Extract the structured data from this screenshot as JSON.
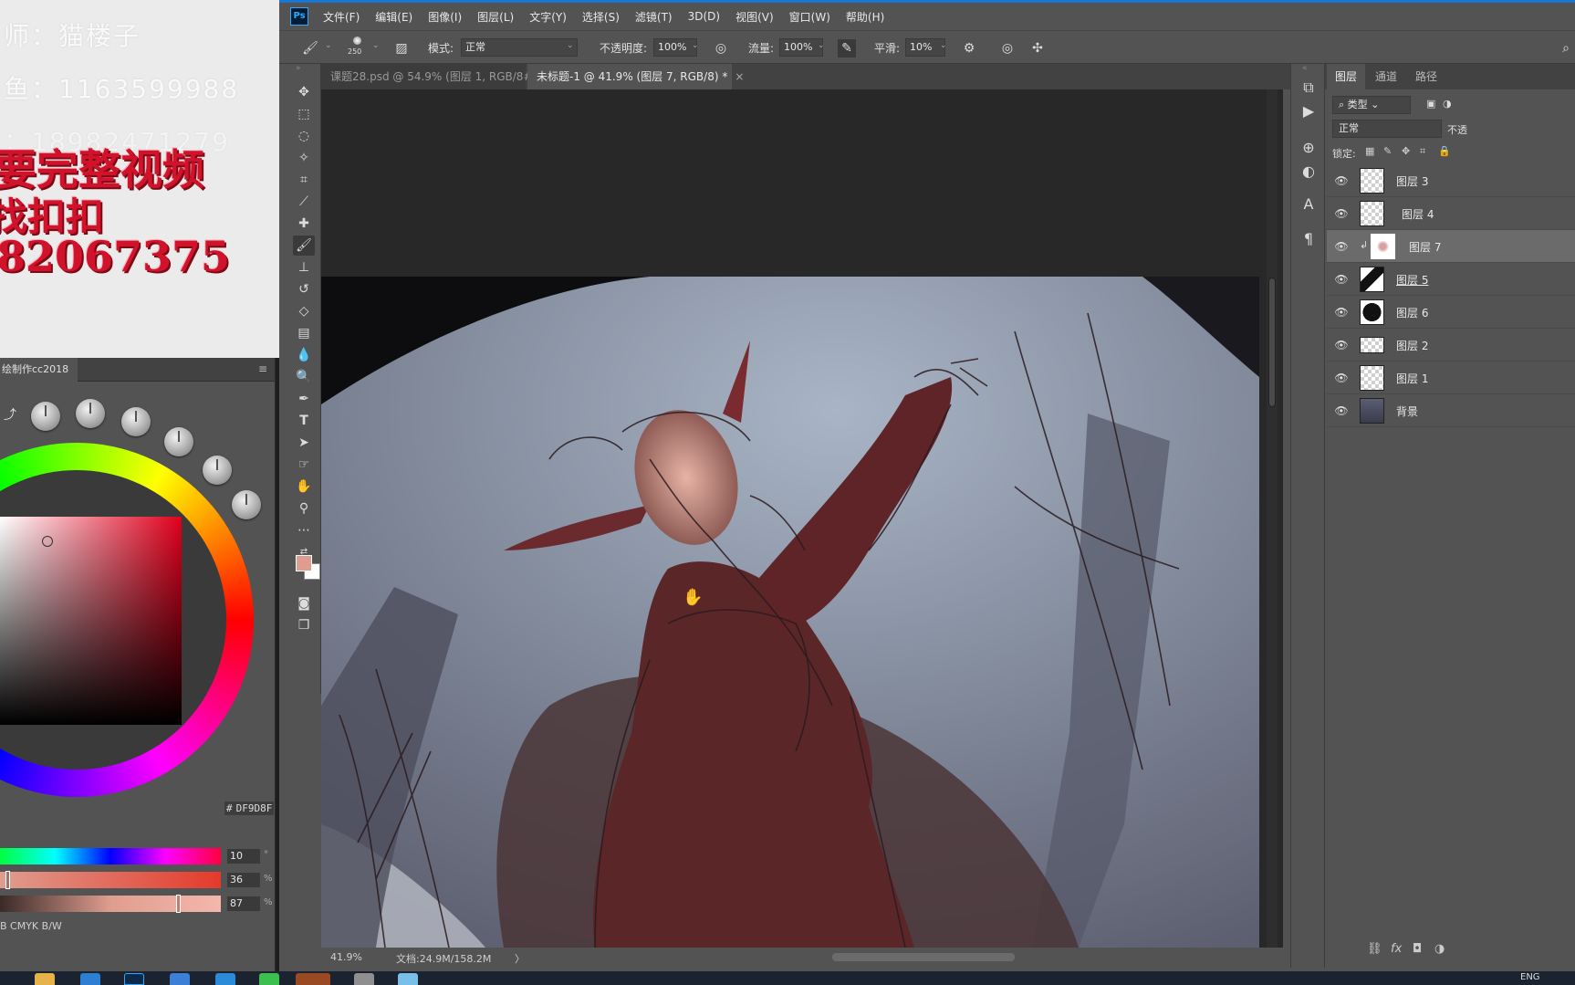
{
  "watermark": {
    "teacher": "师：猫楼子",
    "qq": "鱼：1163599988",
    "partial": "：18982471279",
    "promo_line1": "要完整视频",
    "promo_line2": "找扣扣",
    "promo_number": "82067375"
  },
  "color_panel": {
    "tab_label": "绘制作cc2018",
    "hex_prefix": "#",
    "hex_value": "DF9D8F",
    "sliders": [
      {
        "value": "10",
        "unit": "°",
        "fraction": 0.03
      },
      {
        "value": "36",
        "unit": "%",
        "fraction": 0.36
      },
      {
        "value": "87",
        "unit": "%",
        "fraction": 0.87
      }
    ],
    "modes": "B  CMYK  B/W",
    "colors": {
      "foreground": "#df9d8f",
      "background": "#ffffff"
    }
  },
  "app": {
    "logo": "Ps",
    "menu": [
      "文件(F)",
      "编辑(E)",
      "图像(I)",
      "图层(L)",
      "文字(Y)",
      "选择(S)",
      "滤镜(T)",
      "3D(D)",
      "视图(V)",
      "窗口(W)",
      "帮助(H)"
    ],
    "options": {
      "brush_size": "250",
      "mode_label": "模式:",
      "mode_value": "正常",
      "opacity_label": "不透明度:",
      "opacity_value": "100%",
      "flow_label": "流量:",
      "flow_value": "100%",
      "smoothing_label": "平滑:",
      "smoothing_value": "10%"
    },
    "tabs": [
      {
        "label": "课题28.psd @ 54.9% (图层 1, RGB/8#)",
        "active": false
      },
      {
        "label": "未标题-1 @ 41.9% (图层 7, RGB/8) *",
        "active": true
      }
    ],
    "status": {
      "zoom": "41.9%",
      "doc_info": "文档:24.9M/158.2M",
      "arrow": "〉"
    },
    "tools": [
      "move-tool",
      "marquee-tool",
      "lasso-tool",
      "magic-wand-tool",
      "crop-tool",
      "eyedropper-tool",
      "healing-brush-tool",
      "brush-tool",
      "clone-stamp-tool",
      "history-brush-tool",
      "eraser-tool",
      "gradient-tool",
      "blur-tool",
      "dodge-tool",
      "pen-tool",
      "type-tool",
      "path-select-tool",
      "shape-tool",
      "hand-tool",
      "zoom-tool",
      "more-tools"
    ]
  },
  "layers_panel": {
    "tabs": [
      "图层",
      "通道",
      "路径"
    ],
    "filter_kind": "类型",
    "blend_mode": "正常",
    "opacity_label": "不透",
    "lock_label": "锁定:",
    "layers": [
      {
        "name": "图层 3",
        "selected": false,
        "clipped": false
      },
      {
        "name": "图层 4",
        "selected": false,
        "clipped": false
      },
      {
        "name": "图层 7",
        "selected": true,
        "clipped": true
      },
      {
        "name": "图层 5",
        "selected": false,
        "clipped": false
      },
      {
        "name": "图层 6",
        "selected": false,
        "clipped": false
      },
      {
        "name": "图层 2",
        "selected": false,
        "clipped": false
      },
      {
        "name": "图层 1",
        "selected": false,
        "clipped": false
      },
      {
        "name": "背景",
        "selected": false,
        "clipped": false
      }
    ]
  },
  "taskbar": {
    "lang": "ENG"
  }
}
